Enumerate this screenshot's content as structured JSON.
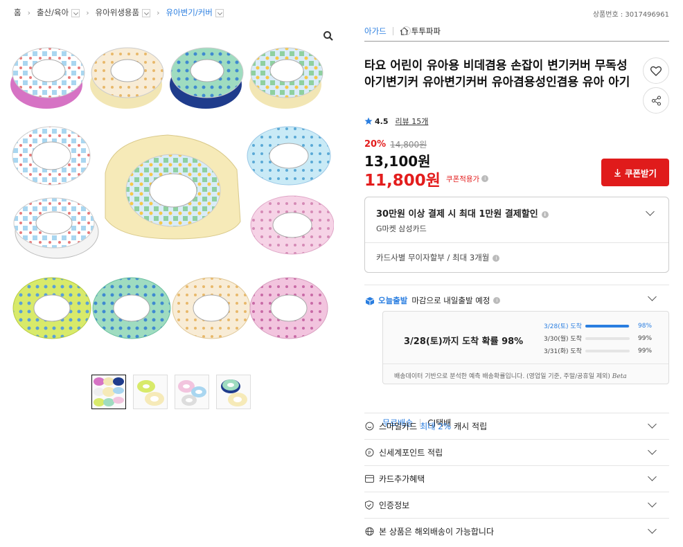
{
  "breadcrumb": {
    "items": [
      "홈",
      "출산/육아",
      "유아위생용품",
      "유아변기/커버"
    ]
  },
  "product_no": "상품번호 : 3017496961",
  "seller": {
    "brand": "아가드",
    "store": "투투파파"
  },
  "title": "타요 어린이 유아용 비데겸용 손잡이 변기커버 무독성 아기변기커 유아변기커버 유아겸용성인겸용 유아 아기",
  "rating": {
    "score": "4.5",
    "review_label": "리뷰 15개"
  },
  "pricing": {
    "discount": "20%",
    "original": "14,800원",
    "price": "13,100원",
    "coupon_price": "11,800원",
    "coupon_label": "쿠폰적용가",
    "coupon_button": "쿠폰받기"
  },
  "card_benefit": {
    "title": "30만원 이상 결제 시 최대 1만원 결제할인",
    "card": "G마켓 삼성카드",
    "installment": "카드사별 무이자할부 / 최대 3개월"
  },
  "shipping": {
    "today_label": "오늘출발",
    "today_text": "마감으로 내일출발 예정",
    "headline": "3/28(토)까지 도착 확률 98%",
    "rows": [
      {
        "date": "3/28(토) 도착",
        "pct": "98%",
        "level": 0.98
      },
      {
        "date": "3/30(월) 도착",
        "pct": "99%",
        "level": 0.0
      },
      {
        "date": "3/31(화) 도착",
        "pct": "99%",
        "level": 0.0
      }
    ],
    "note": "배송데이터 기반으로 분석한 예측 배송확률입니다. (영업일 기준, 주말/공휴일 제외)",
    "beta": "Beta",
    "free_label": "무료배송",
    "courier": "CJ택배"
  },
  "accordions": {
    "smile": {
      "pre": "스마일카드",
      "hl": "최대 2%",
      "post": "캐시 적립"
    },
    "shinsegae": "신세계포인트 적립",
    "card_extra": "카드추가혜택",
    "cert": "인증정보",
    "overseas": "본 상품은 해외배송이 가능합니다"
  },
  "colors": {
    "accent": "#2a7ee0",
    "sale": "#e31d1d",
    "coupon_btn": "#e01b1b"
  }
}
